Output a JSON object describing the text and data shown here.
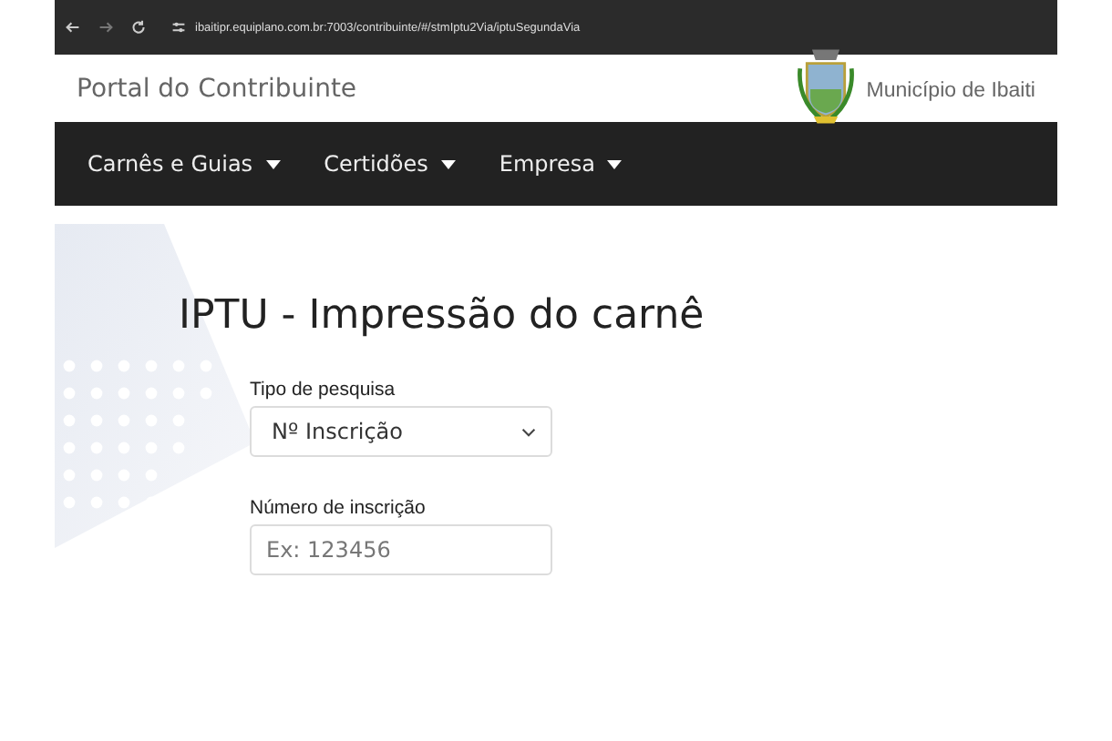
{
  "browser": {
    "url": "ibaitipr.equiplano.com.br:7003/contribuinte/#/stmIptu2Via/iptuSegundaVia"
  },
  "header": {
    "title": "Portal do Contribuinte",
    "municipality": "Município de Ibaiti"
  },
  "nav": [
    {
      "label": "Carnês e Guias"
    },
    {
      "label": "Certidões"
    },
    {
      "label": "Empresa"
    }
  ],
  "page_title": "IPTU - Impressão do carnê",
  "fields": [
    {
      "kind": "select",
      "label": "Tipo de pesquisa",
      "value": "Nº Inscrição"
    },
    {
      "kind": "input",
      "label": "Número de inscrição",
      "placeholder": "Ex: 123456"
    }
  ]
}
